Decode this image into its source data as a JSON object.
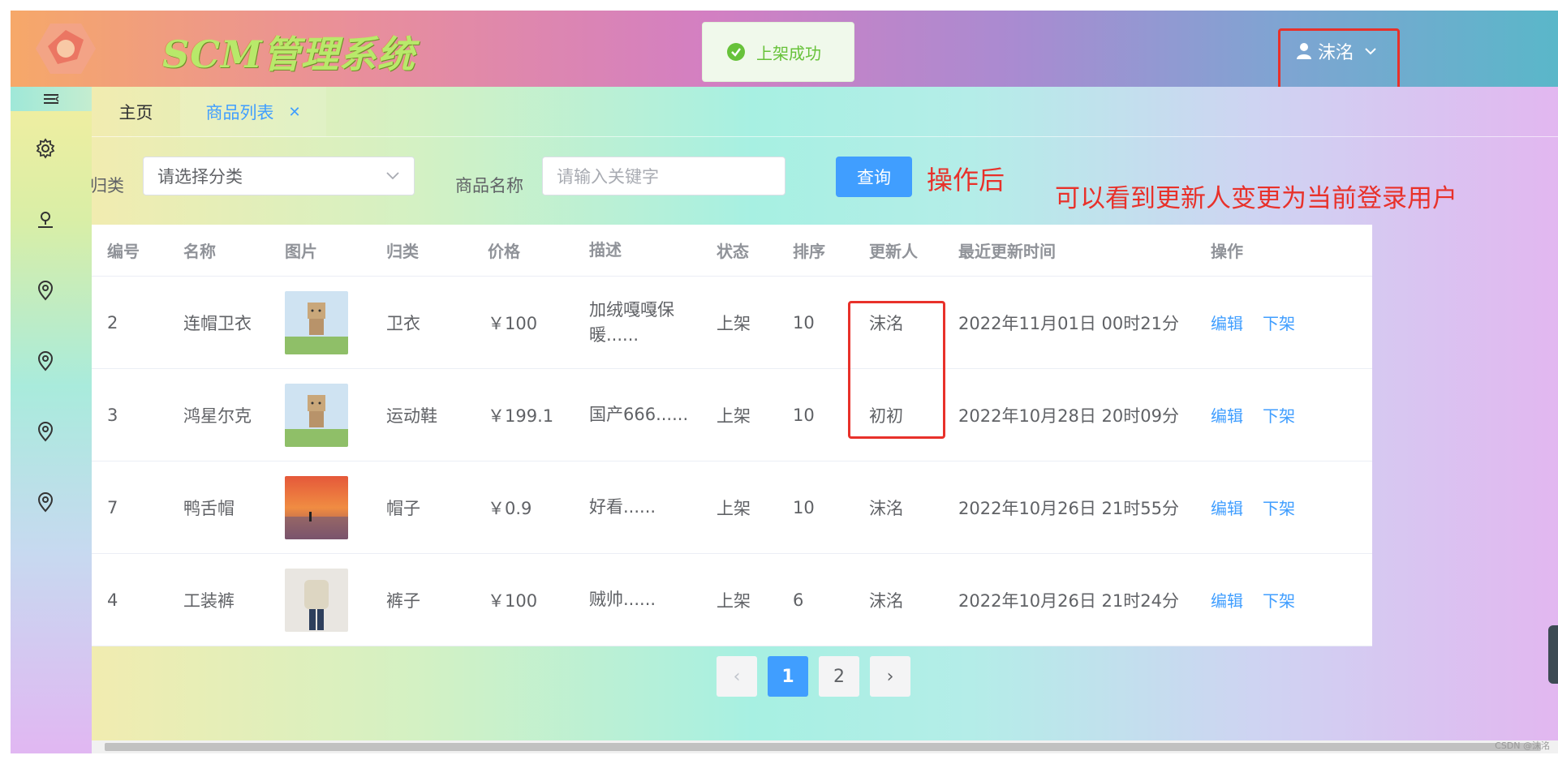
{
  "header": {
    "system_title": "SCM管理系统",
    "user_name": "沫洺"
  },
  "toast": {
    "text": "上架成功",
    "type": "success"
  },
  "sidebar": {
    "icons": [
      "menu-fold-icon",
      "gear-icon",
      "user-icon",
      "location-icon",
      "location-icon",
      "location-icon",
      "location-icon"
    ]
  },
  "tabs": [
    {
      "label": "主页"
    },
    {
      "label": "商品列表",
      "closable": true
    }
  ],
  "filter": {
    "category_label": "归类",
    "category_placeholder": "请选择分类",
    "name_label": "商品名称",
    "name_placeholder": "请输入关键字",
    "query_button": "查询"
  },
  "annotations": {
    "after": "操作后",
    "note": "可以看到更新人变更为当前登录用户",
    "color": "#e8312a"
  },
  "table": {
    "headers": [
      "编号",
      "名称",
      "图片",
      "归类",
      "价格",
      "描述",
      "状态",
      "排序",
      "更新人",
      "最近更新时间",
      "操作"
    ],
    "rows": [
      {
        "id": "2",
        "name": "连帽卫衣",
        "image": "carton-figure",
        "category": "卫衣",
        "price": "￥100",
        "desc": "加绒嘎嘎保暖......",
        "status": "上架",
        "sort": "10",
        "updater": "沫洺",
        "time": "2022年11月01日 00时21分",
        "edit": "编辑",
        "off": "下架"
      },
      {
        "id": "3",
        "name": "鸿星尔克",
        "image": "carton-figure",
        "category": "运动鞋",
        "price": "￥199.1",
        "desc": "国产666......",
        "status": "上架",
        "sort": "10",
        "updater": "初初",
        "time": "2022年10月28日 20时09分",
        "edit": "编辑",
        "off": "下架"
      },
      {
        "id": "7",
        "name": "鸭舌帽",
        "image": "sunset-photo",
        "category": "帽子",
        "price": "￥0.9",
        "desc": "好看......",
        "status": "上架",
        "sort": "10",
        "updater": "沫洺",
        "time": "2022年10月26日 21时55分",
        "edit": "编辑",
        "off": "下架"
      },
      {
        "id": "4",
        "name": "工装裤",
        "image": "person-photo",
        "category": "裤子",
        "price": "￥100",
        "desc": "贼帅......",
        "status": "上架",
        "sort": "6",
        "updater": "沫洺",
        "time": "2022年10月26日 21时24分",
        "edit": "编辑",
        "off": "下架"
      }
    ]
  },
  "pagination": {
    "prev": "‹",
    "pages": [
      "1",
      "2"
    ],
    "current": "1",
    "next": "›"
  },
  "watermark": "CSDN @沫洺",
  "colors": {
    "primary": "#409eff",
    "success": "#67c23a"
  }
}
